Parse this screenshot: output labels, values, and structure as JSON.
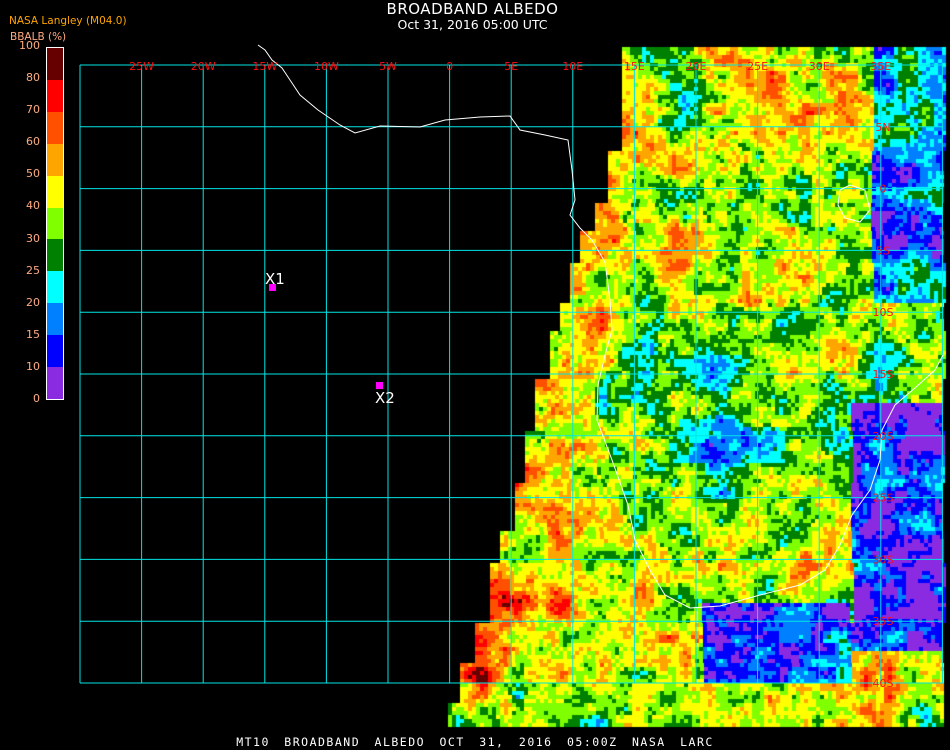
{
  "header": {
    "title": "BROADBAND ALBEDO",
    "subtitle": "Oct 31, 2016 05:00 UTC",
    "organization": "NASA Langley (M04.0)"
  },
  "legend": {
    "unit_label": "BBALB (%)",
    "ticks": [
      "0",
      "10",
      "15",
      "20",
      "25",
      "30",
      "40",
      "50",
      "60",
      "70",
      "80",
      "100"
    ],
    "colors": [
      "#8a2be2",
      "#0000ff",
      "#0080ff",
      "#00ffff",
      "#008000",
      "#80ff00",
      "#ffff00",
      "#ffa500",
      "#ff5000",
      "#ff0000",
      "#660000"
    ]
  },
  "map": {
    "longitude_labels": [
      "25W",
      "20W",
      "15W",
      "10W",
      "5W",
      "0",
      "5E",
      "10E",
      "15E",
      "20E",
      "25E",
      "30E",
      "35E"
    ],
    "latitude_labels": [
      "5N",
      "0",
      "5S",
      "10S",
      "15S",
      "20S",
      "25S",
      "30S",
      "35S",
      "40S"
    ],
    "grid_color": "#00e5e5",
    "coast_color": "#ffffff",
    "markers": [
      {
        "label": "X1",
        "color": "#ff00ff"
      },
      {
        "label": "X2",
        "color": "#ff00ff"
      }
    ]
  },
  "footer": {
    "text": "MT10  BROADBAND ALBEDO   OCT 31, 2016 05:00Z   NASA LARC"
  }
}
